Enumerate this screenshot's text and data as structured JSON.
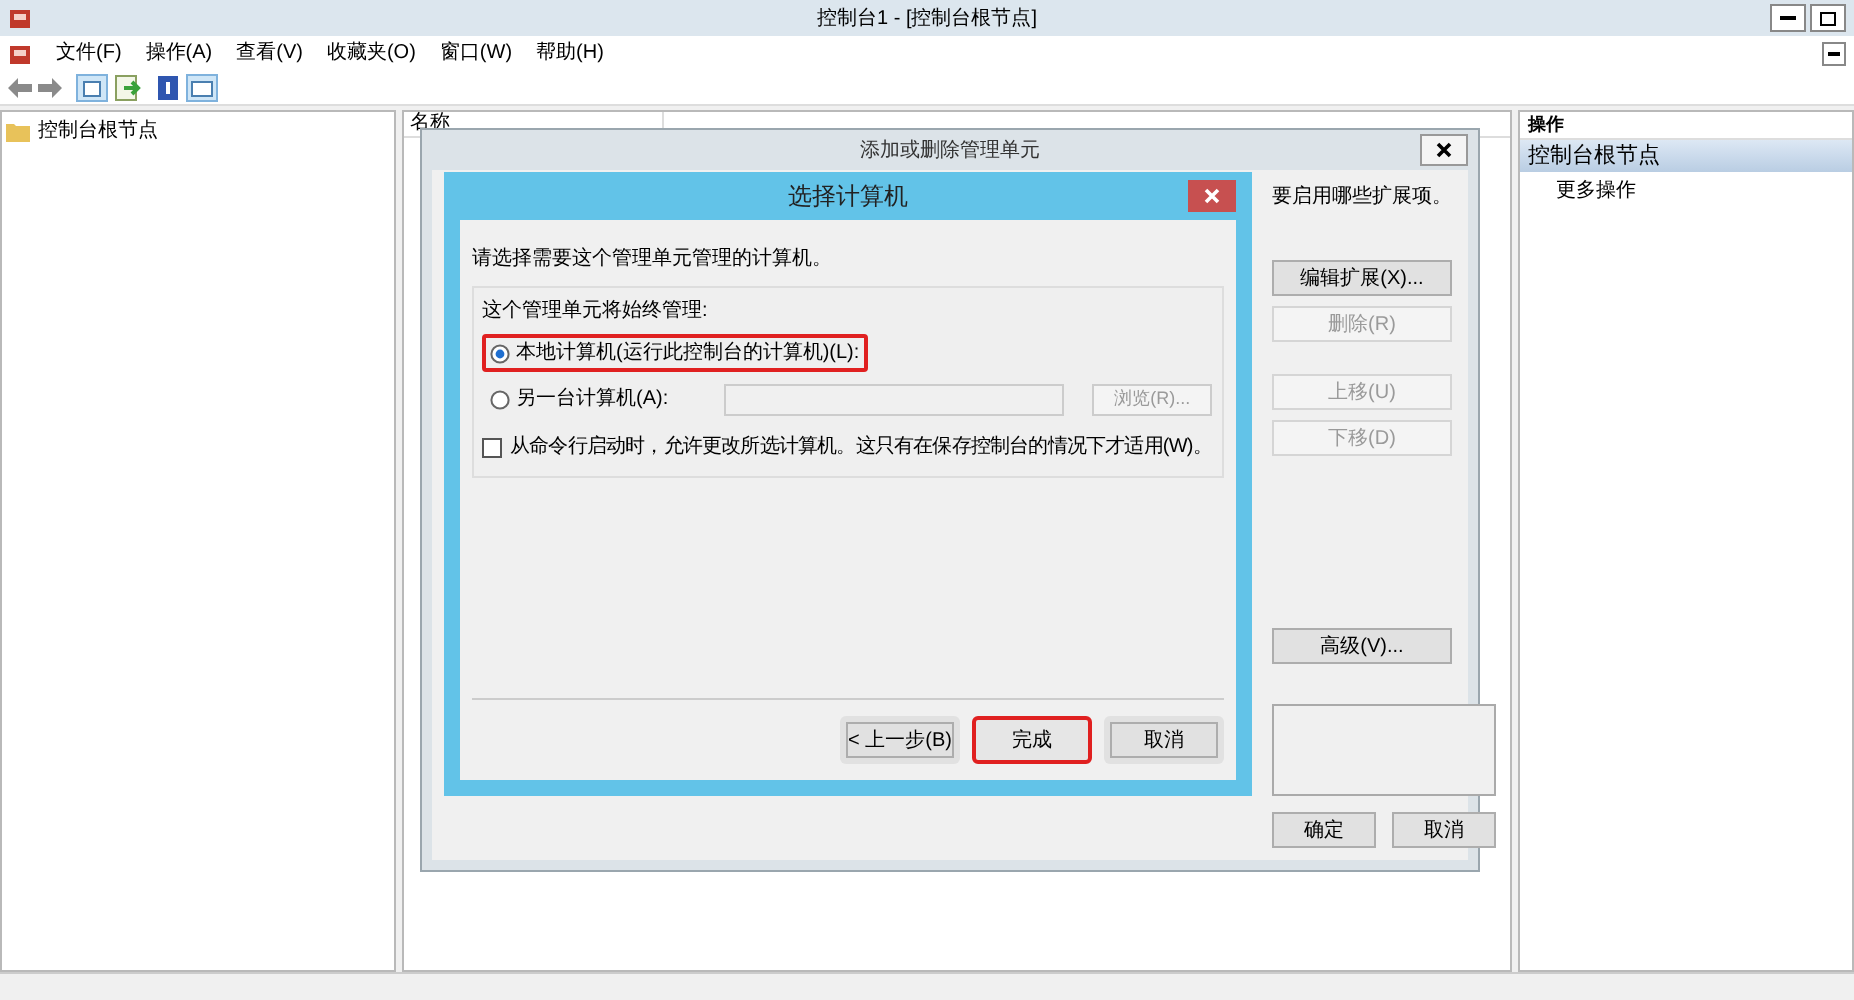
{
  "window": {
    "title": "控制台1 - [控制台根节点]"
  },
  "menu": [
    "文件(F)",
    "操作(A)",
    "查看(V)",
    "收藏夹(O)",
    "窗口(W)",
    "帮助(H)"
  ],
  "tree": {
    "items": [
      {
        "label": "控制台根节点"
      }
    ]
  },
  "center": {
    "column": "名称"
  },
  "actions": {
    "header": "操作",
    "items": [
      {
        "label": "控制台根节点",
        "kind": "section"
      },
      {
        "label": "更多操作",
        "kind": "item"
      }
    ]
  },
  "snapin_dialog": {
    "title": "添加或删除管理单元",
    "text": "要启用哪些扩展项。",
    "side_buttons": [
      {
        "label": "编辑扩展(X)...",
        "disabled": false
      },
      {
        "label": "删除(R)",
        "disabled": true
      },
      {
        "label": "上移(U)",
        "disabled": true
      },
      {
        "label": "下移(D)",
        "disabled": true
      },
      {
        "label": "高级(V)...",
        "disabled": false
      }
    ],
    "buttons": [
      "确定",
      "取消"
    ]
  },
  "computer_dialog": {
    "title": "选择计算机",
    "instruction": "请选择需要这个管理单元管理的计算机。",
    "group_label": "这个管理单元将始终管理:",
    "options": [
      {
        "label": "本地计算机(运行此控制台的计算机)(L):",
        "selected": true,
        "highlighted": true
      },
      {
        "label": "另一台计算机(A):",
        "selected": false,
        "highlighted": false
      }
    ],
    "browse_button": {
      "label": "浏览(R)...",
      "disabled": true
    },
    "checkbox": {
      "label": "从命令行启动时，允许更改所选计算机。这只有在保存控制台的情况下才适用(W)。",
      "checked": false
    },
    "buttons": [
      {
        "label": "< 上一步(B)",
        "highlighted": false
      },
      {
        "label": "完成",
        "highlighted": true
      },
      {
        "label": "取消",
        "highlighted": false
      }
    ]
  }
}
